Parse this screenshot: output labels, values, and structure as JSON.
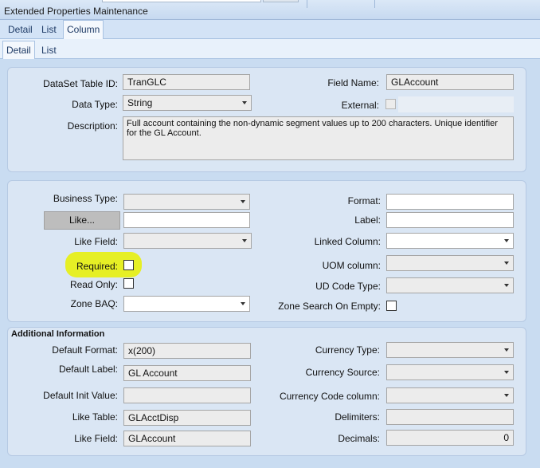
{
  "window": {
    "title": "Extended Properties Maintenance"
  },
  "tabs_top": [
    "Detail",
    "List",
    "Column"
  ],
  "tabs_sub": [
    "Detail",
    "List"
  ],
  "dataset": {
    "table_id_label": "DataSet Table ID:",
    "table_id_value": "TranGLC",
    "data_type_label": "Data Type:",
    "data_type_value": "String",
    "description_label": "Description:",
    "description_value": "Full account containing the non-dynamic segment values up to 200 characters.  Unique identifier for the GL Account.",
    "field_name_label": "Field Name:",
    "field_name_value": "GLAccount",
    "external_label": "External:"
  },
  "props": {
    "business_type_label": "Business Type:",
    "like_button": "Like...",
    "like_field_label": "Like Field:",
    "required_label": "Required:",
    "read_only_label": "Read Only:",
    "zone_baq_label": "Zone BAQ:",
    "format_label": "Format:",
    "label_label": "Label:",
    "linked_column_label": "Linked Column:",
    "uom_column_label": "UOM column:",
    "ud_code_type_label": "UD Code Type:",
    "zone_search_label": "Zone Search On Empty:"
  },
  "additional": {
    "section_title": "Additional Information",
    "default_format_label": "Default Format:",
    "default_format_value": "x(200)",
    "default_label_label": "Default Label:",
    "default_label_value": "GL Account",
    "default_init_label": "Default Init Value:",
    "like_table_label": "Like Table:",
    "like_table_value": "GLAcctDisp",
    "like_field_label": "Like Field:",
    "like_field_value": "GLAccount",
    "currency_type_label": "Currency Type:",
    "currency_source_label": "Currency Source:",
    "currency_code_label": "Currency Code column:",
    "delimiters_label": "Delimiters:",
    "decimals_label": "Decimals:",
    "decimals_value": "0"
  },
  "colors": {
    "highlight": "#e8f000",
    "panel": "#dae6f4",
    "background": "#c9dcf1"
  }
}
